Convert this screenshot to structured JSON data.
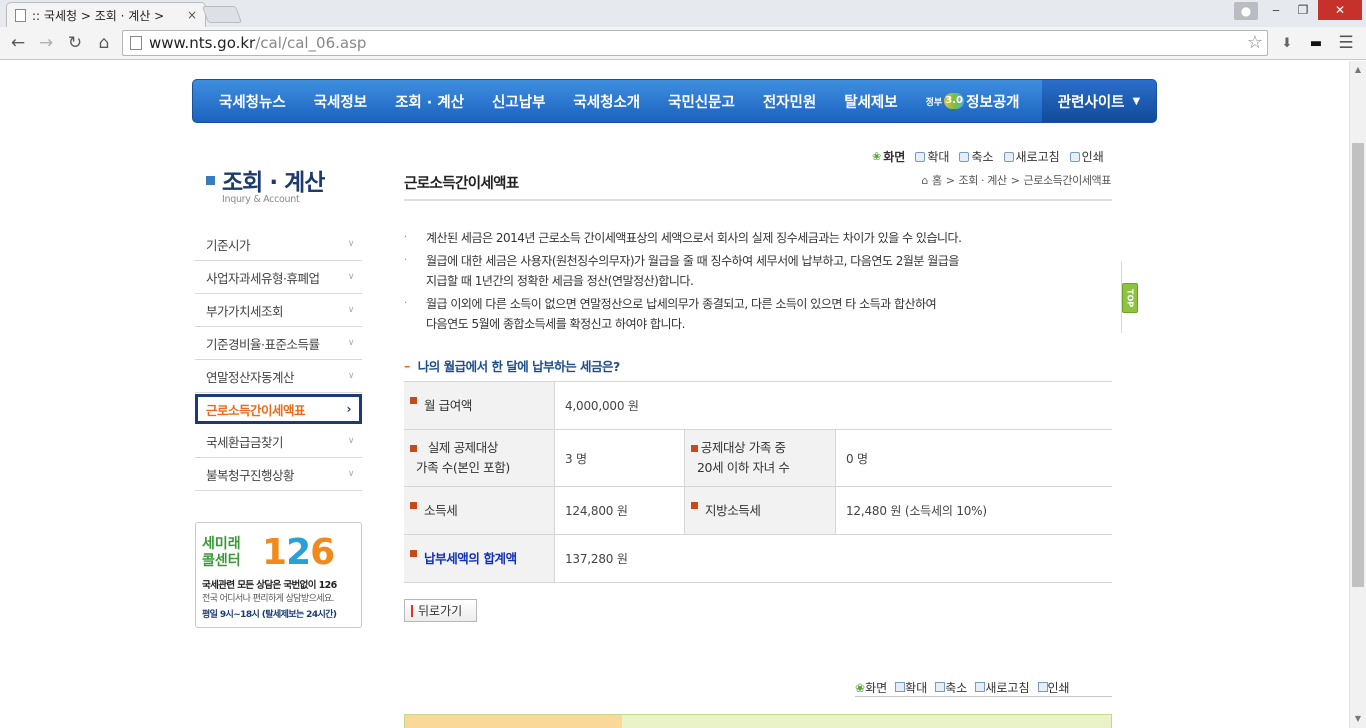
{
  "browser": {
    "tab_title": ":: 국세청 > 조회 · 계산 >",
    "tab_close": "×",
    "url_host": "www.nts.go.kr",
    "url_path": "/cal/cal_06.asp",
    "win_min": "‒",
    "win_max": "❐",
    "win_close": "✕"
  },
  "gnb": {
    "items": [
      "국세청뉴스",
      "국세정보",
      "조회 · 계산",
      "신고납부",
      "국세청소개",
      "국민신문고",
      "전자민원",
      "탈세제보"
    ],
    "info_gov": "정부",
    "info_label": "정보공개",
    "related": "관련사이트"
  },
  "lnb": {
    "title": "조회 · 계산",
    "subtitle": "Inqury & Account",
    "items": [
      "기준시가",
      "사업자과세유형·휴폐업",
      "부가가치세조회",
      "기준경비율·표준소득률",
      "연말정산자동계산",
      "근로소득간이세액표",
      "국세환급금찾기",
      "불복청구진행상황"
    ]
  },
  "banner": {
    "kor1": "세미래",
    "kor2": "콜센터",
    "num1": "1",
    "num2": "2",
    "num3": "6",
    "line1": "국세관련 모든 상담은 국번없이 126",
    "line2": "전국 어디서나 편리하게 상담받으세요.",
    "line3": "평일 9시~18시 (탈세제보는 24시간)"
  },
  "util": {
    "screen": "화면",
    "zoom_in": "확대",
    "zoom_out": "축소",
    "refresh": "새로고침",
    "print": "인쇄"
  },
  "content": {
    "title": "근로소득간이세액표",
    "breadcrumb": [
      "홈",
      "조회 · 계산",
      "근로소득간이세액표"
    ],
    "notes": [
      [
        "계산된 세금은 2014년 근로소득 간이세액표상의 세액으로서 회사의 실제 징수세금과는 차이가 있을 수 있습니다."
      ],
      [
        "월급에 대한 세금은 사용자(원천징수의무자)가 월급을 줄 때 징수하여 세무서에 납부하고, 다음연도 2월분 월급을",
        "지급할 때 1년간의 정확한 세금을 정산(연말정산)합니다."
      ],
      [
        "월급 이외에 다른 소득이 없으면 연말정산으로 납세의무가 종결되고, 다른 소득이 있으면 타 소득과 합산하여",
        "다음연도 5월에 종합소득세를 확정신고 하여야 합니다."
      ]
    ],
    "section_title": "나의 월급에서 한 달에 납부하는 세금은?",
    "rows": {
      "salary_label": "월 급여액",
      "salary_value": "4,000,000 원",
      "deduct_label_1": "실제 공제대상",
      "deduct_label_2": "가족 수(본인 포함)",
      "deduct_value": "3 명",
      "child_label_1": "공제대상 가족 중",
      "child_label_2": "20세 이하 자녀 수",
      "child_value": "0 명",
      "income_tax_label": "소득세",
      "income_tax_value": "124,800 원",
      "local_tax_label": "지방소득세",
      "local_tax_value": "12,480 원 (소득세의 10%)",
      "total_label": "납부세액의 합계액",
      "total_value": "137,280 원"
    },
    "back_button": "뒤로가기",
    "top_button": "TOP"
  }
}
